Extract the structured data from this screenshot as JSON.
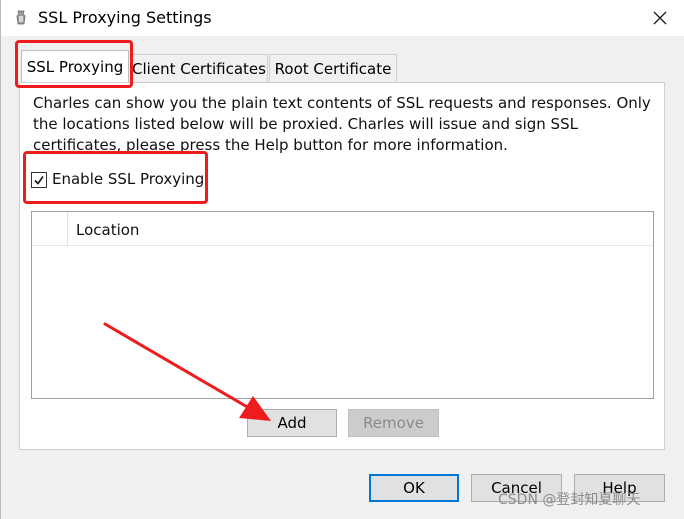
{
  "window": {
    "title": "SSL Proxying Settings",
    "app_icon": "charles-icon",
    "close_icon": "close-icon"
  },
  "tabs": [
    {
      "label": "SSL Proxying",
      "active": true
    },
    {
      "label": "Client Certificates",
      "active": false
    },
    {
      "label": "Root Certificate",
      "active": false
    }
  ],
  "panel": {
    "description": "Charles can show you the plain text contents of SSL requests and responses. Only the locations listed below will be proxied. Charles will issue and sign SSL certificates, please press the Help button for more information.",
    "enable_checkbox": {
      "label": "Enable SSL Proxying",
      "checked": true
    },
    "table": {
      "columns": [
        "",
        "Location"
      ],
      "rows": []
    },
    "buttons": {
      "add": "Add",
      "remove": "Remove"
    }
  },
  "footer": {
    "ok": "OK",
    "cancel": "Cancel",
    "help": "Help"
  },
  "watermark": "CSDN @登封知夏聊天",
  "colors": {
    "annotation_red": "#ee1c1c",
    "focus_blue": "#0078d7"
  }
}
